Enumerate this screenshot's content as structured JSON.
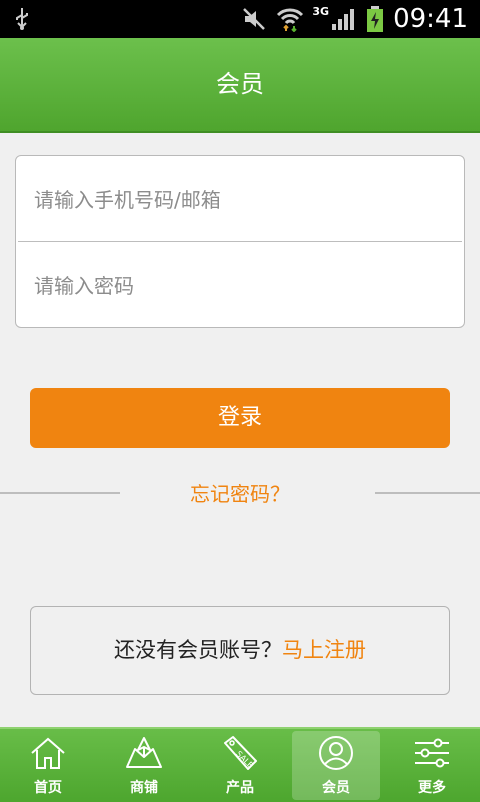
{
  "status_bar": {
    "network": "3G",
    "time": "09:41",
    "icons": [
      "usb-icon",
      "mute-icon",
      "wifi-icon",
      "signal-icon",
      "battery-icon"
    ]
  },
  "header": {
    "title": "会员"
  },
  "login_form": {
    "account_placeholder": "请输入手机号码/邮箱",
    "password_placeholder": "请输入密码",
    "login_label": "登录",
    "forgot_label": "忘记密码？"
  },
  "register": {
    "prompt": "还没有会员账号？",
    "link_label": "马上注册"
  },
  "tabbar": {
    "items": [
      {
        "label": "首页",
        "icon": "home-icon"
      },
      {
        "label": "商铺",
        "icon": "store-map-icon"
      },
      {
        "label": "产品",
        "icon": "sale-tag-icon"
      },
      {
        "label": "会员",
        "icon": "member-icon"
      },
      {
        "label": "更多",
        "icon": "sliders-icon"
      }
    ],
    "active_index": 3
  },
  "colors": {
    "accent_orange": "#f08410",
    "header_green": "#5bb23a"
  }
}
